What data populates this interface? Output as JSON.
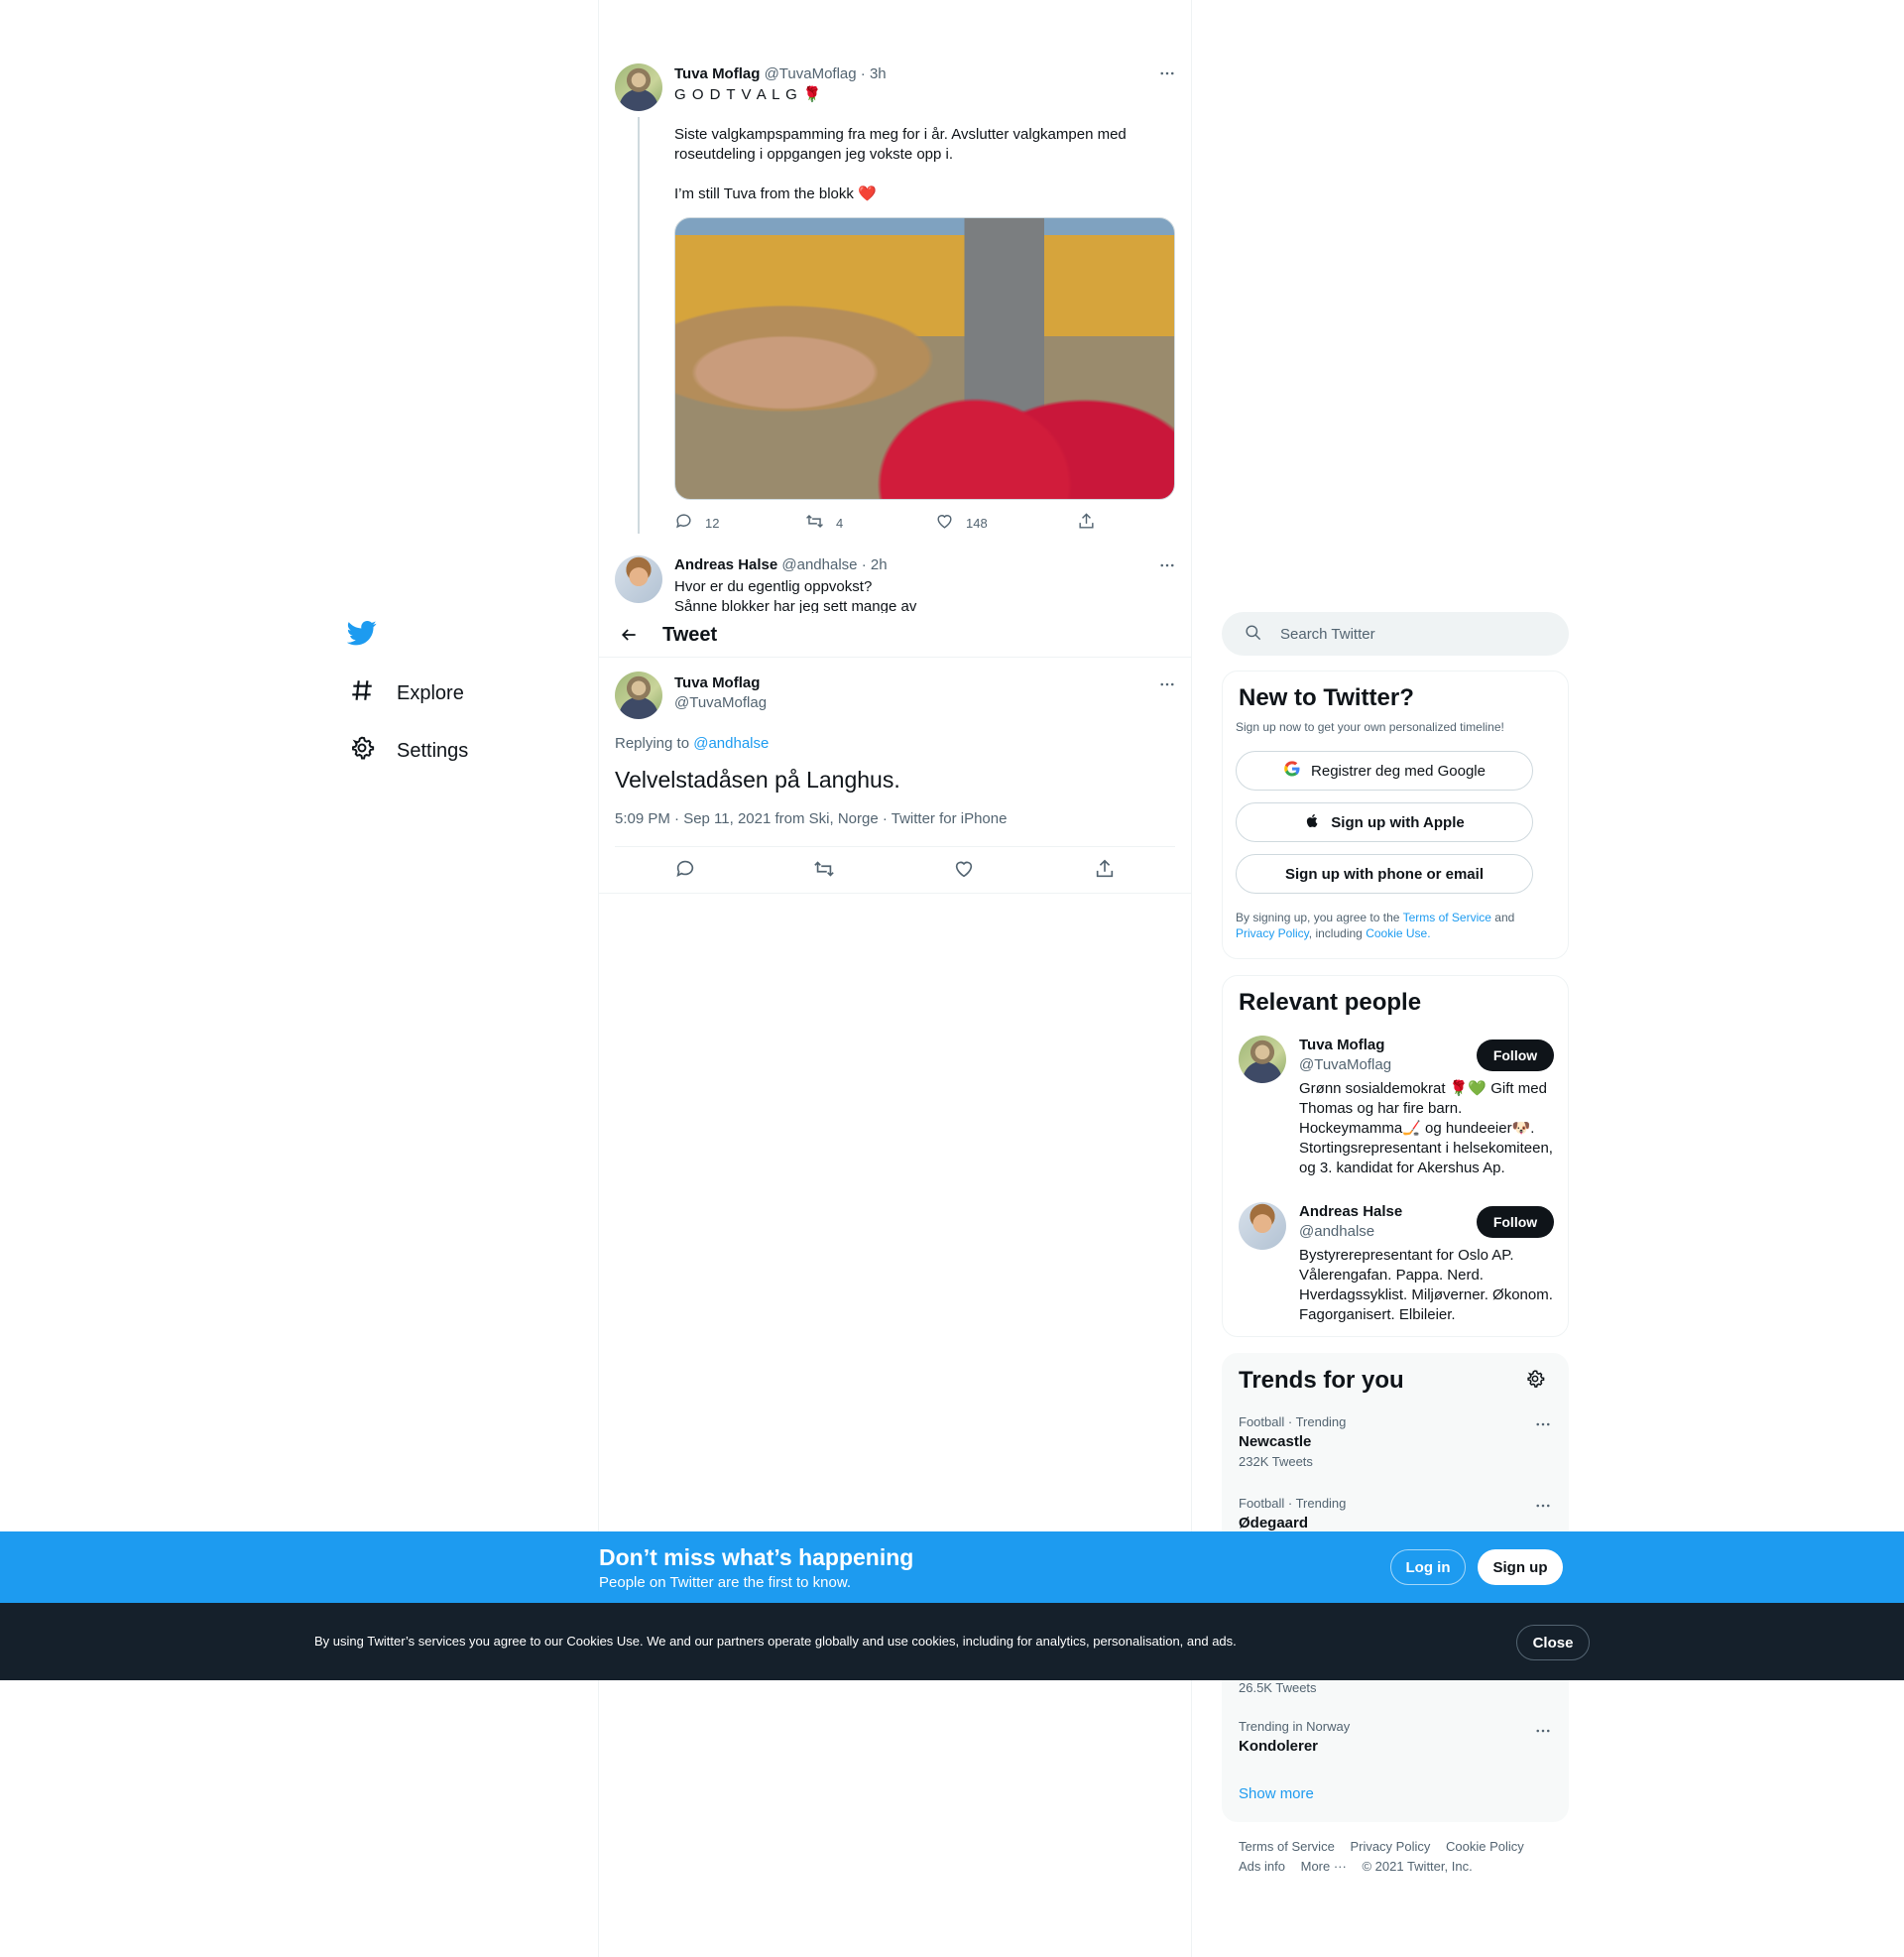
{
  "nav": {
    "explore": "Explore",
    "settings": "Settings"
  },
  "thread": {
    "tweet1": {
      "name": "Tuva Moflag",
      "handle": "@TuvaMoflag",
      "time": "· 3h",
      "line1": "G O D T   V A L G 🌹",
      "para1a": "Siste valgkampspamming fra meg for i år. Avslutter valgkampen med",
      "para1b": "roseutdeling i oppgangen jeg vokste opp i.",
      "para2": "I’m still Tuva from the blokk ❤️",
      "replies": "12",
      "retweets": "4",
      "likes": "148"
    },
    "tweet2": {
      "name": "Andreas Halse",
      "handle": "@andhalse",
      "time": "· 2h",
      "line1": "Hvor er du egentlig oppvokst?",
      "line2": "Sånne blokker har jeg sett mange av"
    }
  },
  "header": {
    "title": "Tweet"
  },
  "main_tweet": {
    "name": "Tuva Moflag",
    "handle": "@TuvaMoflag",
    "replying_prefix": "Replying to",
    "replying_handle": "@andhalse",
    "text": "Velvelstadåsen på Langhus.",
    "meta": "5:09 PM · Sep 11, 2021 from Ski, Norge · Twitter for iPhone"
  },
  "search": {
    "placeholder": "Search Twitter"
  },
  "new_to_twitter": {
    "title": "New to Twitter?",
    "subtitle": "Sign up now to get your own personalized timeline!",
    "google_btn": "Registrer deg med Google",
    "apple_btn": "Sign up with Apple",
    "phone_btn": "Sign up with phone or email",
    "legal_prefix": "By signing up, you agree to the",
    "terms": "Terms of Service",
    "and": "and",
    "privacy": "Privacy Policy",
    "including": ", including",
    "cookie": "Cookie Use."
  },
  "relevant": {
    "title": "Relevant people",
    "people": [
      {
        "name": "Tuva Moflag",
        "handle": "@TuvaMoflag",
        "follow": "Follow",
        "bio": [
          "Grønn sosialdemokrat 🌹💚 Gift med",
          "Thomas og har fire barn.",
          "Hockeymamma🏒 og hundeeier🐶.",
          "Stortingsrepresentant i helsekomiteen,",
          "og 3. kandidat for Akershus Ap."
        ]
      },
      {
        "name": "Andreas Halse",
        "handle": "@andhalse",
        "follow": "Follow",
        "bio": [
          "Bystyrerepresentant for Oslo AP.",
          "Vålerengafan. Pappa. Nerd.",
          "Hverdagssyklist. Miljøverner. Økonom.",
          "Fagorganisert. Elbileier."
        ]
      }
    ]
  },
  "trends": {
    "title": "Trends for you",
    "items": [
      {
        "meta": "Football · Trending",
        "name": "Newcastle",
        "count": "232K Tweets"
      },
      {
        "meta": "Football · Trending",
        "name": "Ødegaard"
      },
      {
        "count": "26.5K Tweets"
      },
      {
        "meta": "Trending in Norway",
        "name": "Kondolerer"
      }
    ],
    "show_more": "Show more"
  },
  "footer": {
    "terms": "Terms of Service",
    "privacy": "Privacy Policy",
    "cookie": "Cookie Policy",
    "ads": "Ads info",
    "more": "More ···",
    "copyright": "© 2021 Twitter, Inc."
  },
  "signup_bar": {
    "headline": "Don’t miss what’s happening",
    "sub": "People on Twitter are the first to know.",
    "login": "Log in",
    "signup": "Sign up"
  },
  "cookie_bar": {
    "text": "By using Twitter’s services you agree to our Cookies Use. We and our partners operate globally and use cookies, including for analytics, personalisation, and ads.",
    "close": "Close"
  },
  "colors": {
    "accent": "#1d9bf0",
    "text": "#0f1419",
    "muted": "#536471",
    "cookie_bar": "#15202b"
  }
}
